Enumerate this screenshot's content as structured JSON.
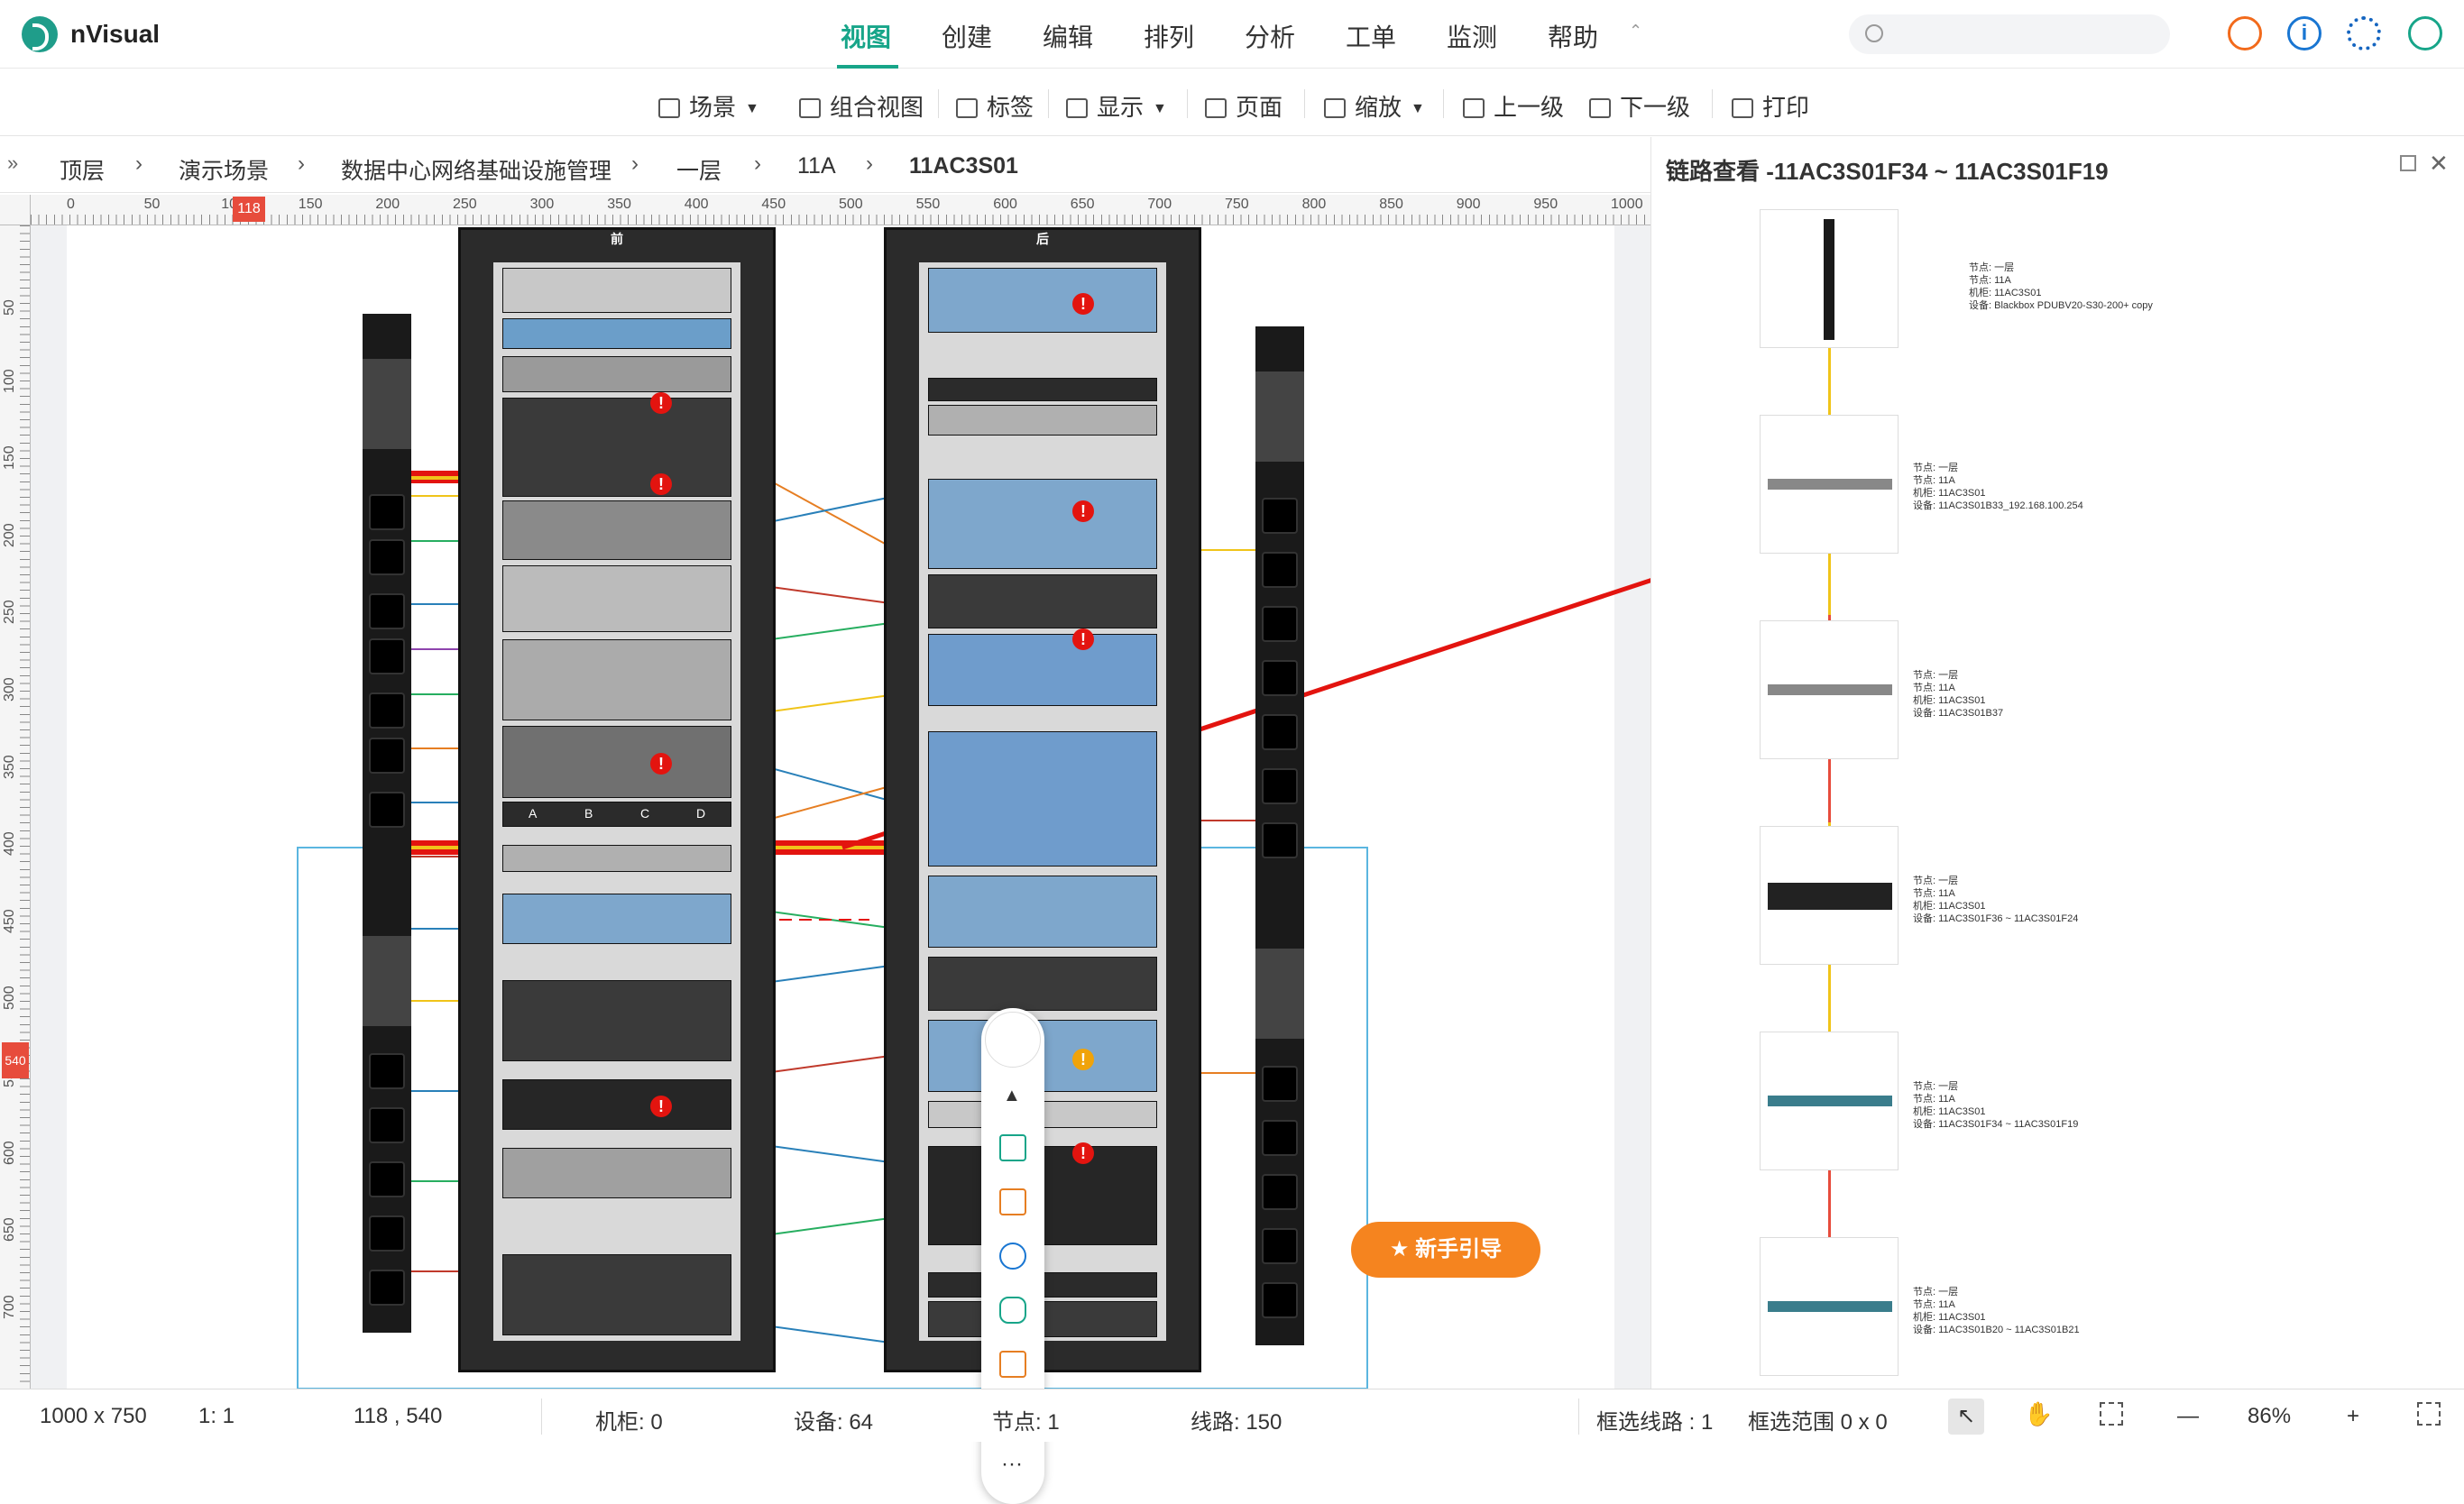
{
  "app": {
    "brand": "nVisual"
  },
  "nav": {
    "items": [
      {
        "label": "视图",
        "active": true
      },
      {
        "label": "创建",
        "active": false
      },
      {
        "label": "编辑",
        "active": false
      },
      {
        "label": "排列",
        "active": false
      },
      {
        "label": "分析",
        "active": false
      },
      {
        "label": "工单",
        "active": false
      },
      {
        "label": "监测",
        "active": false
      },
      {
        "label": "帮助",
        "active": false
      }
    ],
    "collapse_icon": "chevron-up-icon",
    "accent": "#17a589"
  },
  "header_icons": [
    "clock-pie-icon",
    "info-icon",
    "gear-icon",
    "user-icon"
  ],
  "search": {
    "placeholder": ""
  },
  "toolbar": {
    "scene": "场景",
    "combined_view": "组合视图",
    "label": "标签",
    "display": "显示",
    "page": "页面",
    "zoom": "缩放",
    "up_level": "上一级",
    "down_level": "下一级",
    "print": "打印"
  },
  "breadcrumb": [
    "顶层",
    "演示场景",
    "数据中心网络基础设施管理",
    "一层",
    "11A",
    "11AC3S01"
  ],
  "ruler": {
    "h_labels": [
      "0",
      "50",
      "100",
      "150",
      "200",
      "250",
      "300",
      "350",
      "400",
      "450",
      "500",
      "550",
      "600",
      "650",
      "700",
      "750",
      "800",
      "850",
      "900",
      "950",
      "1000"
    ],
    "h_marker": "118",
    "v_labels": [
      "50",
      "100",
      "150",
      "200",
      "250",
      "300",
      "350",
      "400",
      "450",
      "500",
      "550",
      "600",
      "650",
      "700"
    ],
    "v_marker": "540"
  },
  "canvas": {
    "rack_front_label": "前",
    "rack_back_label": "后",
    "patch_labels": [
      "A",
      "B",
      "C",
      "D"
    ],
    "guide_button": "新手引导",
    "guide_color": "#f5841f",
    "alert_color": "#e3140f",
    "float_tools": [
      "chevron-up-icon",
      "image-icon",
      "list-icon",
      "topology-icon",
      "route-icon",
      "hierarchy-icon",
      "monitor-icon",
      "more-icon"
    ]
  },
  "panel": {
    "title": "链路查看 -11AC3S01F34 ~ 11AC3S01F19",
    "cards": [
      {
        "info": "节点: 一层\n节点: 11A\n机柜: 11AC3S01\n设备: Blackbox PDUBV20-S30-200+ copy"
      },
      {
        "info": "节点: 一层\n节点: 11A\n机柜: 11AC3S01\n设备: 11AC3S01B33_192.168.100.254"
      },
      {
        "info": "节点: 一层\n节点: 11A\n机柜: 11AC3S01\n设备: 11AC3S01B37"
      },
      {
        "info": "节点: 一层\n节点: 11A\n机柜: 11AC3S01\n设备: 11AC3S01F36 ~ 11AC3S01F24"
      },
      {
        "info": "节点: 一层\n节点: 11A\n机柜: 11AC3S01\n设备: 11AC3S01F34 ~ 11AC3S01F19"
      },
      {
        "info": "节点: 一层\n节点: 11A\n机柜: 11AC3S01\n设备: 11AC3S01B20 ~ 11AC3S01B21"
      }
    ],
    "link_colors": [
      "#f0c419",
      "#e74c3c"
    ]
  },
  "status": {
    "size": "1000 x 750",
    "scale": "1: 1",
    "coords": "118 , 540",
    "racks": "机柜: 0",
    "devices": "设备: 64",
    "nodes": "节点: 1",
    "lines": "线路: 150",
    "selected_lines": "框选线路 : 1",
    "selected_range": "框选范围 0 x 0",
    "zoom": "86%",
    "minus": "—",
    "plus": "+"
  }
}
